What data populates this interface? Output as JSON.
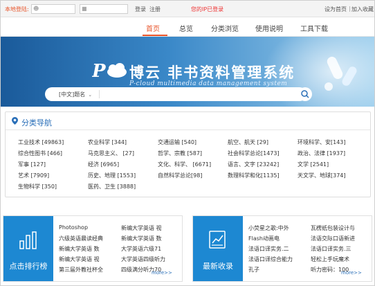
{
  "topbar": {
    "local_login_label": "本地登陆:",
    "login_link": "登录",
    "register_link": "注册",
    "ip_status": "您的IP已登录",
    "set_homepage": "设为首页",
    "add_favorite": "加入收藏",
    "separator": "|"
  },
  "nav": {
    "items": [
      {
        "label": "首页"
      },
      {
        "label": "总览"
      },
      {
        "label": "分类浏览"
      },
      {
        "label": "使用说明"
      },
      {
        "label": "工具下载"
      }
    ]
  },
  "banner": {
    "title": "博云 非书资料管理系统",
    "subtitle": "P-cloud  multimedia data management system",
    "search_scope": "[中文]题名"
  },
  "category": {
    "title": "分类导航",
    "items": [
      "工业技术 [49863]",
      "农业科学 [344]",
      "交通运输 [540]",
      "航空、航天 [29]",
      "环境科学、安[143]",
      "综合性图书 [466]",
      "马克思主义、 [27]",
      "哲学、宗教 [587]",
      "社会科学总论[1473]",
      "政治、法律 [1937]",
      "军事 [127]",
      "经济 [6965]",
      "文化、科学、 [6671]",
      "语言、文字 [23242]",
      "文学 [2541]",
      "艺术 [7909]",
      "历史、地理 [1553]",
      "自然科学总论[98]",
      "数理科学和化[1135]",
      "天文学、地球[374]",
      "生物科学 [350]",
      "医药、卫生 [3888]"
    ]
  },
  "panels": {
    "ranking": {
      "label": "点击排行榜",
      "col1": [
        "Photoshop",
        "六级英语晨读经典",
        "新编大学英语 数",
        "新编大学英语 视",
        "第三届外教社杯全"
      ],
      "col2": [
        "新编大学英语 视",
        "新编大学英语 数",
        "大学英语六级71",
        "大学英语四级听力",
        "四级满分听力70"
      ],
      "more": "more>>"
    },
    "latest": {
      "label": "最新收录",
      "col1": [
        "小荧星之歌:中外",
        "Flash动画电",
        "法语口译实务.二",
        "法语口译综合能力",
        "孔子"
      ],
      "col2": [
        "瓦楞纸包装设计与",
        "法语交际口语新进",
        "法语口译实务.三",
        "轻松上手玩魔术",
        "听力密码：100"
      ],
      "more": "more>>"
    }
  }
}
